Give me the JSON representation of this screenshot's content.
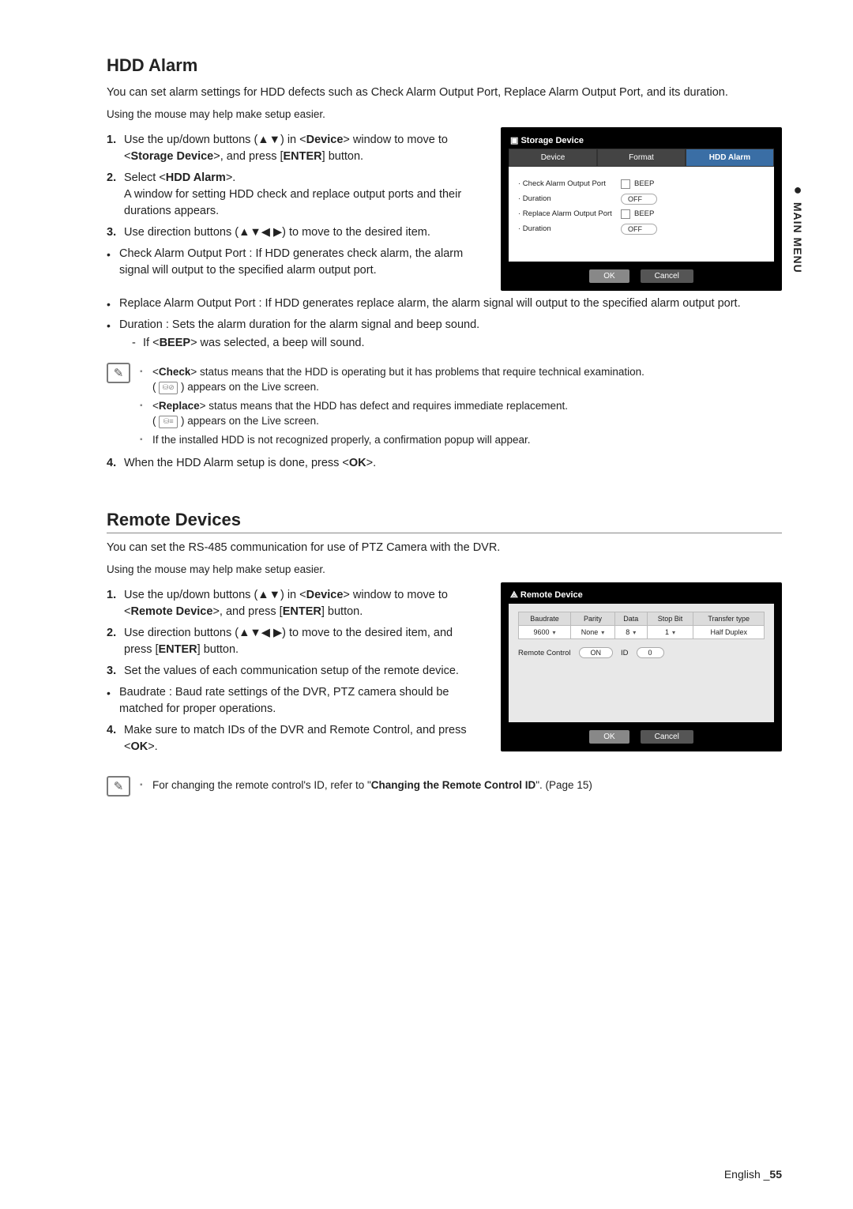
{
  "side_tab": {
    "dot": "●",
    "label": "MAIN MENU"
  },
  "section1": {
    "title": "HDD Alarm",
    "intro": "You can set alarm settings for HDD defects such as Check Alarm Output Port, Replace Alarm Output Port, and its duration.",
    "mouse_hint": "Using the mouse may help make setup easier.",
    "step1_num": "1.",
    "step1_a": "Use the up/down buttons (▲▼) in <",
    "step1_b": "Device",
    "step1_c": "> window to move to <",
    "step1_d": "Storage Device",
    "step1_e": ">, and press [",
    "step1_f": "ENTER",
    "step1_g": "] button.",
    "step2_num": "2.",
    "step2_a": "Select <",
    "step2_b": "HDD Alarm",
    "step2_c": ">.",
    "step2_desc": "A window for setting HDD check and replace output ports and their durations appears.",
    "step3_num": "3.",
    "step3_a": "Use direction buttons (▲▼◀ ▶) to move to the desired item.",
    "bullet_check": "Check Alarm Output Port : If HDD generates check alarm, the alarm signal will output to the specified alarm output port.",
    "bullet_replace": "Replace Alarm Output Port : If HDD generates replace alarm, the alarm signal will output to the specified alarm output port.",
    "bullet_duration": "Duration : Sets the alarm duration for the alarm signal and beep sound.",
    "sub_beep_a": "If <",
    "sub_beep_b": "BEEP",
    "sub_beep_c": "> was selected, a beep will sound.",
    "note1_a": "<",
    "note1_b": "Check",
    "note1_c": "> status means that the HDD is operating but it has problems that require technical examination.",
    "note1_d": "( ",
    "note1_e": " ) appears on the Live screen.",
    "note2_a": "<",
    "note2_b": "Replace",
    "note2_c": "> status means that the HDD has defect and requires immediate replacement.",
    "note2_d": "( ",
    "note2_e": " ) appears on the Live screen.",
    "note3": "If the installed HDD is not recognized properly, a confirmation popup will appear.",
    "step4_num": "4.",
    "step4_a": "When the HDD Alarm setup is done, press <",
    "step4_b": "OK",
    "step4_c": ">."
  },
  "dlg1": {
    "title": "Storage Device",
    "tab1": "Device",
    "tab2": "Format",
    "tab3": "HDD Alarm",
    "row1_label": "· Check Alarm Output Port",
    "row1_beep": "BEEP",
    "row2_label": "· Duration",
    "row2_val": "OFF",
    "row3_label": "· Replace Alarm Output Port",
    "row3_beep": "BEEP",
    "row4_label": "· Duration",
    "row4_val": "OFF",
    "ok": "OK",
    "cancel": "Cancel"
  },
  "section2": {
    "title": "Remote Devices",
    "intro": "You can set the RS-485 communication for use of PTZ Camera with the DVR.",
    "mouse_hint": "Using the mouse may help make setup easier.",
    "step1_num": "1.",
    "step1_a": "Use the up/down buttons (▲▼) in <",
    "step1_b": "Device",
    "step1_c": "> window to move to <",
    "step1_d": "Remote Device",
    "step1_e": ">, and press [",
    "step1_f": "ENTER",
    "step1_g": "] button.",
    "step2_num": "2.",
    "step2_a": "Use direction buttons (▲▼◀ ▶) to move to the desired item, and press [",
    "step2_b": "ENTER",
    "step2_c": "] button.",
    "step3_num": "3.",
    "step3_a": "Set the values of each communication setup of the remote device.",
    "bullet_baud": "Baudrate : Baud rate settings of the DVR, PTZ camera should be matched for proper operations.",
    "step4_num": "4.",
    "step4_a": "Make sure to match IDs of the DVR and Remote Control, and press <",
    "step4_b": "OK",
    "step4_c": ">.",
    "note_a": "For changing the remote control's ID, refer to \"",
    "note_b": "Changing the Remote Control ID",
    "note_c": "\". (Page 15)"
  },
  "dlg2": {
    "title": "Remote Device",
    "th1": "Baudrate",
    "th2": "Parity",
    "th3": "Data",
    "th4": "Stop Bit",
    "th5": "Transfer type",
    "td1": "9600",
    "td2": "None",
    "td3": "8",
    "td4": "1",
    "td5": "Half Duplex",
    "rc_label": "Remote Control",
    "rc_on": "ON",
    "rc_id_label": "ID",
    "rc_id": "0",
    "ok": "OK",
    "cancel": "Cancel"
  },
  "footer": {
    "lang": "English _",
    "page": "55"
  }
}
